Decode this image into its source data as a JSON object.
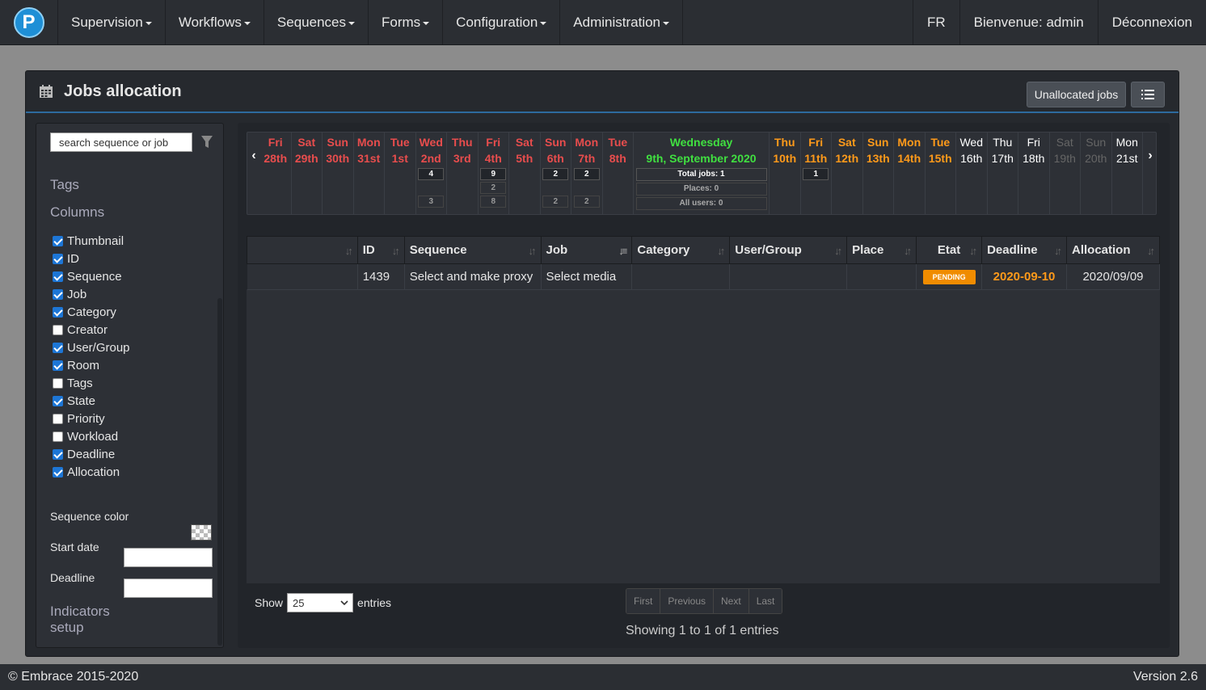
{
  "navbar": {
    "logo_letter": "P",
    "menus": [
      "Supervision",
      "Workflows",
      "Sequences",
      "Forms",
      "Configuration",
      "Administration"
    ],
    "lang": "FR",
    "welcome": "Bienvenue: admin",
    "logout": "Déconnexion"
  },
  "panel": {
    "title": "Jobs allocation",
    "unallocated_label": "Unallocated jobs"
  },
  "sidebar": {
    "search_placeholder": "search sequence or job",
    "tags_heading": "Tags",
    "columns_heading": "Columns",
    "columns": [
      {
        "label": "Thumbnail",
        "checked": true
      },
      {
        "label": "ID",
        "checked": true
      },
      {
        "label": "Sequence",
        "checked": true
      },
      {
        "label": "Job",
        "checked": true
      },
      {
        "label": "Category",
        "checked": true
      },
      {
        "label": "Creator",
        "checked": false
      },
      {
        "label": "User/Group",
        "checked": true
      },
      {
        "label": "Room",
        "checked": true
      },
      {
        "label": "Tags",
        "checked": false
      },
      {
        "label": "State",
        "checked": true
      },
      {
        "label": "Priority",
        "checked": false
      },
      {
        "label": "Workload",
        "checked": false
      },
      {
        "label": "Deadline",
        "checked": true
      },
      {
        "label": "Allocation",
        "checked": true
      }
    ],
    "sequence_color_label": "Sequence color",
    "start_date_label": "Start date",
    "deadline_label": "Deadline",
    "indicators_label_1": "Indicators",
    "indicators_label_2": "setup"
  },
  "calendar": {
    "days": [
      {
        "dow": "Fri",
        "date": "28th",
        "kind": "past",
        "counts": []
      },
      {
        "dow": "Sat",
        "date": "29th",
        "kind": "past",
        "counts": []
      },
      {
        "dow": "Sun",
        "date": "30th",
        "kind": "past",
        "counts": []
      },
      {
        "dow": "Mon",
        "date": "31st",
        "kind": "past",
        "counts": []
      },
      {
        "dow": "Tue",
        "date": "1st",
        "kind": "past",
        "counts": []
      },
      {
        "dow": "Wed",
        "date": "2nd",
        "kind": "past",
        "counts": [
          "4",
          "",
          "3"
        ]
      },
      {
        "dow": "Thu",
        "date": "3rd",
        "kind": "past",
        "counts": []
      },
      {
        "dow": "Fri",
        "date": "4th",
        "kind": "past",
        "counts": [
          "9",
          "2",
          "8"
        ]
      },
      {
        "dow": "Sat",
        "date": "5th",
        "kind": "past",
        "counts": []
      },
      {
        "dow": "Sun",
        "date": "6th",
        "kind": "past",
        "counts": [
          "2",
          "",
          "2"
        ]
      },
      {
        "dow": "Mon",
        "date": "7th",
        "kind": "past",
        "counts": [
          "2",
          "",
          "2"
        ]
      },
      {
        "dow": "Tue",
        "date": "8th",
        "kind": "past",
        "counts": []
      }
    ],
    "today": {
      "line1": "Wednesday",
      "line2": "9th, September 2020",
      "total_jobs": "Total jobs: 1",
      "places": "Places: 0",
      "all_users": "All users: 0"
    },
    "days_after": [
      {
        "dow": "Thu",
        "date": "10th",
        "kind": "wk",
        "counts": []
      },
      {
        "dow": "Fri",
        "date": "11th",
        "kind": "wk",
        "counts": [
          "1"
        ]
      },
      {
        "dow": "Sat",
        "date": "12th",
        "kind": "wk",
        "counts": []
      },
      {
        "dow": "Sun",
        "date": "13th",
        "kind": "wk",
        "counts": []
      },
      {
        "dow": "Mon",
        "date": "14th",
        "kind": "wk",
        "counts": []
      },
      {
        "dow": "Tue",
        "date": "15th",
        "kind": "wk",
        "counts": []
      },
      {
        "dow": "Wed",
        "date": "16th",
        "kind": "fut",
        "counts": []
      },
      {
        "dow": "Thu",
        "date": "17th",
        "kind": "fut",
        "counts": []
      },
      {
        "dow": "Fri",
        "date": "18th",
        "kind": "fut",
        "counts": []
      },
      {
        "dow": "Sat",
        "date": "19th",
        "kind": "off",
        "counts": []
      },
      {
        "dow": "Sun",
        "date": "20th",
        "kind": "off",
        "counts": []
      },
      {
        "dow": "Mon",
        "date": "21st",
        "kind": "fut",
        "counts": []
      }
    ]
  },
  "table": {
    "headers": [
      "",
      "ID",
      "Sequence",
      "Job",
      "Category",
      "User/Group",
      "Place",
      "Etat",
      "Deadline",
      "Allocation"
    ],
    "rows": [
      {
        "thumb": "",
        "id": "1439",
        "sequence": "Select and make proxy",
        "job": "Select media",
        "category": "",
        "user_group": "",
        "place": "",
        "etat": "PENDING",
        "deadline": "2020-09-10",
        "allocation": "2020/09/09"
      }
    ]
  },
  "footer_controls": {
    "show_label": "Show",
    "page_size": "25",
    "entries_label": "entries",
    "pager": [
      "First",
      "Previous",
      "Next",
      "Last"
    ],
    "info": "Showing 1 to 1 of 1 entries"
  },
  "footer": {
    "copyright": "© Embrace 2015-2020",
    "version": "Version 2.6"
  },
  "colors": {
    "past_day": "#e84d4d",
    "upcoming_day": "#ff9a1a",
    "today": "#40e040",
    "pending_badge": "#f08c00",
    "accent_border": "#2d6a9e"
  }
}
